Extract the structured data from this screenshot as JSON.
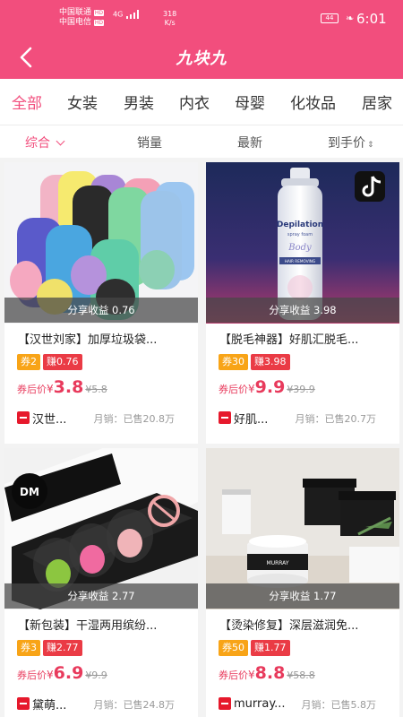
{
  "status_bar": {
    "carrier_1": "中国联通",
    "carrier_2": "中国电信",
    "network_label": "HD",
    "signal_label": "4G",
    "speed_value": "318",
    "speed_unit": "K/s",
    "battery": "44",
    "time": "6:01"
  },
  "header": {
    "title": "九块九",
    "back_icon": "back-arrow-icon"
  },
  "categories": [
    {
      "label": "全部",
      "active": true
    },
    {
      "label": "女装"
    },
    {
      "label": "男装"
    },
    {
      "label": "内衣"
    },
    {
      "label": "母婴"
    },
    {
      "label": "化妆品"
    },
    {
      "label": "居家"
    }
  ],
  "sorts": [
    {
      "label": "综合",
      "active": true,
      "icon": "chevron-down-icon"
    },
    {
      "label": "销量"
    },
    {
      "label": "最新"
    },
    {
      "label": "到手价",
      "icon": "sort-updown-icon"
    }
  ],
  "products": [
    {
      "share": "分享收益 0.76",
      "name": "【汉世刘家】加厚垃圾袋...",
      "coupon": "券2",
      "earn": "赚0.76",
      "price_label": "券后价",
      "currency": "¥",
      "price": "3.8",
      "original_price": "¥5.8",
      "shop": "汉世...",
      "sales": "月销：已售20.8万"
    },
    {
      "share": "分享收益 3.98",
      "name": "【脱毛神器】好肌汇脱毛...",
      "coupon": "券30",
      "earn": "赚3.98",
      "price_label": "券后价",
      "currency": "¥",
      "price": "9.9",
      "original_price": "¥39.9",
      "shop": "好肌...",
      "sales": "月销：已售20.7万"
    },
    {
      "share": "分享收益 2.77",
      "name": "【新包装】干湿两用缤纷...",
      "coupon": "券3",
      "earn": "赚2.77",
      "price_label": "券后价",
      "currency": "¥",
      "price": "6.9",
      "original_price": "¥9.9",
      "shop": "黛萌...",
      "sales": "月销：已售24.8万"
    },
    {
      "share": "分享收益 1.77",
      "name": "【烫染修复】深层滋润免...",
      "coupon": "券50",
      "earn": "赚1.77",
      "price_label": "券后价",
      "currency": "¥",
      "price": "8.8",
      "original_price": "¥58.8",
      "shop": "murray...",
      "sales": "月销：已售5.8万"
    }
  ],
  "image_text": {
    "product_2_brand": "Depilation",
    "product_2_sub": "spray foam",
    "product_2_word": "Body",
    "product_2_band": "HAIR REMOVING",
    "product_3_logo": "DM",
    "product_4_brand": "MURRAY"
  },
  "colors": {
    "brand": "#f24e7d",
    "price": "#e83a5c",
    "coupon": "#f8a417",
    "earn": "#ea3b45"
  }
}
